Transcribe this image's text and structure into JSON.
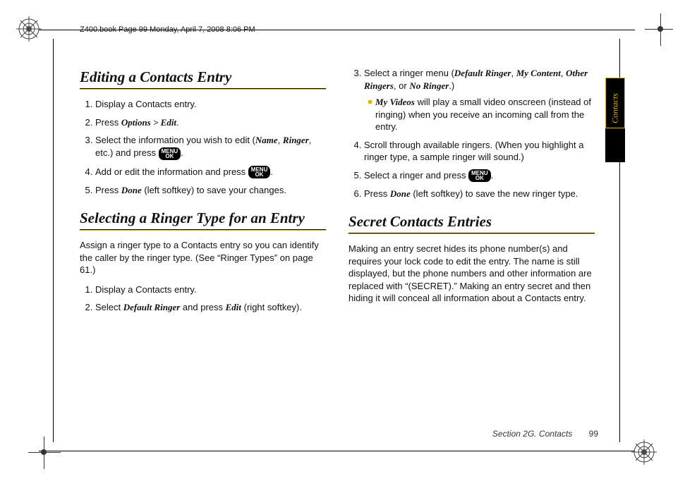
{
  "header": "Z400.book  Page 99  Monday, April 7, 2008  8:06 PM",
  "sideTab": "Contacts",
  "keyLabel": "MENU\nOK",
  "col1": {
    "sec1": {
      "title": "Editing a Contacts Entry",
      "steps": {
        "s1": "Display a Contacts entry.",
        "s2a": "Press ",
        "s2b": "Options > Edit",
        "s2c": ".",
        "s3a": "Select the information you wish to edit (",
        "s3b": "Name",
        "s3c": ", ",
        "s3d": "Ringer",
        "s3e": ", etc.) and press ",
        "s3f": ".",
        "s4a": "Add or edit the information and press ",
        "s4b": ".",
        "s5a": "Press ",
        "s5b": "Done",
        "s5c": " (left softkey) to save your changes."
      }
    },
    "sec2": {
      "title": "Selecting a Ringer Type for an Entry",
      "intro": "Assign a ringer type to a Contacts entry so you can identify the caller by the ringer type. (See “Ringer Types” on page 61.)",
      "steps": {
        "s1": "Display a Contacts entry.",
        "s2a": "Select ",
        "s2b": "Default Ringer",
        "s2c": " and press ",
        "s2d": "Edit",
        "s2e": " (right softkey)."
      }
    }
  },
  "col2": {
    "sec2cont": {
      "s3a": "Select a ringer menu (",
      "s3b": "Default Ringer",
      "s3c": ", ",
      "s3d": "My Content",
      "s3e": ", ",
      "s3f": "Other Ringers",
      "s3g": ", or ",
      "s3h": "No Ringer",
      "s3i": ".)",
      "sub_a": "My Videos",
      "sub_b": " will play a small video onscreen (instead of ringing) when you receive an incoming call from the entry.",
      "s4": "Scroll through available ringers. (When you highlight a ringer type, a sample ringer will sound.)",
      "s5a": "Select a ringer and press ",
      "s5b": ".",
      "s6a": "Press ",
      "s6b": "Done",
      "s6c": " (left softkey) to save the new ringer type."
    },
    "sec3": {
      "title": "Secret Contacts Entries",
      "body": "Making an entry secret hides its phone number(s) and requires your lock code to edit the entry. The name is still displayed, but the phone numbers and other information are replaced with “(SECRET).” Making an entry secret and then hiding it will conceal all information about a Contacts entry."
    }
  },
  "footer": {
    "section": "Section 2G. Contacts",
    "page": "99"
  }
}
